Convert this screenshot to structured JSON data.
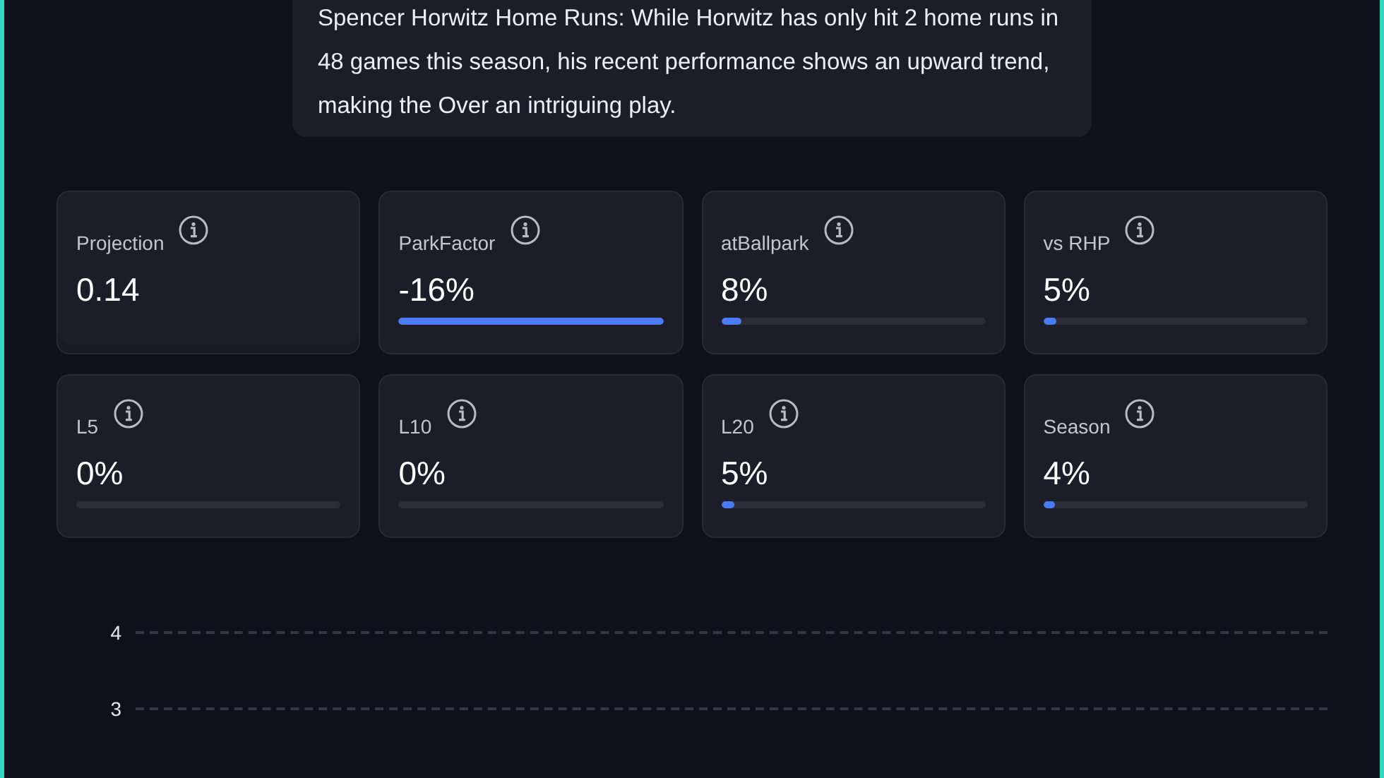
{
  "summary": "Spencer Horwitz Home Runs: While Horwitz has only hit 2 home runs in 48 games this season, his recent performance shows an upward trend, making the Over an intriguing play.",
  "stats": [
    {
      "kind": "value",
      "label": "Projection",
      "value": "0.14"
    },
    {
      "kind": "bar",
      "label": "ParkFactor",
      "value": "-16%",
      "level": 1
    },
    {
      "kind": "bar",
      "label": "atBallpark",
      "value": "8%",
      "level": 0.08
    },
    {
      "kind": "bar",
      "label": "vs RHP",
      "value": "5%",
      "level": 0.05
    },
    {
      "kind": "bar",
      "label": "L5",
      "value": "0%",
      "level": 0
    },
    {
      "kind": "bar",
      "label": "L10",
      "value": "0%",
      "level": 0
    },
    {
      "kind": "bar",
      "label": "L20",
      "value": "5%",
      "level": 0.05
    },
    {
      "kind": "bar",
      "label": "Season",
      "value": "4%",
      "level": 0.04
    }
  ],
  "chart": {
    "y_labels": [
      "4",
      "3"
    ]
  }
}
